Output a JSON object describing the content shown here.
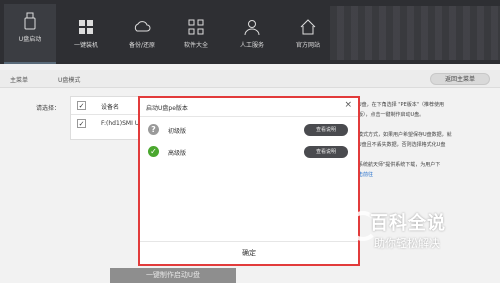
{
  "toolbar": {
    "items": [
      {
        "label": "U盘启动",
        "icon": "usb-drive-icon"
      },
      {
        "label": "一键装机",
        "icon": "windows-icon"
      },
      {
        "label": "备份/还原",
        "icon": "cloud-icon"
      },
      {
        "label": "软件大全",
        "icon": "grid-icon"
      },
      {
        "label": "人工服务",
        "icon": "person-icon"
      },
      {
        "label": "官方网站",
        "icon": "home-icon"
      }
    ]
  },
  "breadcrumb": {
    "home": "主菜单",
    "current": "U盘模式",
    "back_label": "返回主菜单"
  },
  "background": {
    "select_label": "请选择：",
    "table_header": "设备名",
    "table_row": "F:(hd1)SMI U",
    "right_text": [
      "U盘，在下角选择 \"PE版本\"（推荐使用",
      "版），点击一键制作启动U盘。",
      "",
      "模式方式，如果用户希望保存U盘数据，就",
      "U盘且不丢失数据，否则选择格式化U盘",
      "",
      "系统航天师\"提供系统下载，为用户下",
      "击前往"
    ],
    "make_button": "一键制作启动U盘"
  },
  "dialog": {
    "title": "启动U盘pe版本",
    "close": "×",
    "options": [
      {
        "name": "初级版",
        "button": "查看说明",
        "state": "?",
        "checked": false
      },
      {
        "name": "高级版",
        "button": "查看说明",
        "state": "✓",
        "checked": true
      }
    ],
    "confirm": "确定",
    "border_color": "#e23b3b"
  },
  "watermark": {
    "title": "百科全说",
    "subtitle": "助你轻松解决"
  }
}
